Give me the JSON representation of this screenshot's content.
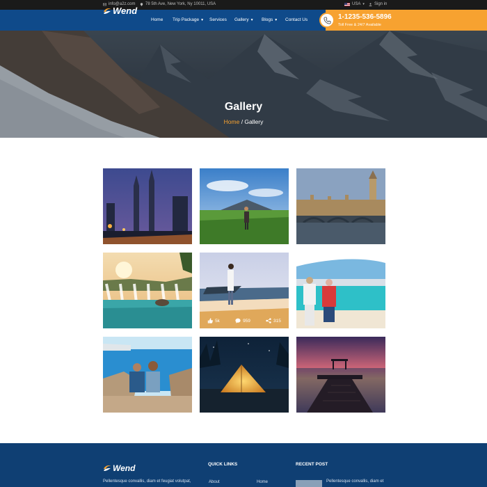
{
  "topbar": {
    "email": "info@a2z.com",
    "address": "78 5th Ave, New York, Ny 10011, USA",
    "language": "USA",
    "signin": "Sign in"
  },
  "nav": {
    "logo": "Wend",
    "items": [
      {
        "label": "Home",
        "dropdown": false
      },
      {
        "label": "Trip Package",
        "dropdown": true
      },
      {
        "label": "Services",
        "dropdown": false
      },
      {
        "label": "Gallery",
        "dropdown": true
      },
      {
        "label": "Blogs",
        "dropdown": true
      },
      {
        "label": "Contact Us",
        "dropdown": false
      }
    ],
    "phone": "1-1235-536-5896",
    "phone_note": "Toll Free & 24/7 Available"
  },
  "hero": {
    "title": "Gallery",
    "crumb_home": "Home",
    "crumb_sep": " / ",
    "crumb_current": "Gallery"
  },
  "gallery": {
    "images": [
      {
        "name": "city-towers-night"
      },
      {
        "name": "hiker-volcano"
      },
      {
        "name": "london-parliament"
      },
      {
        "name": "waterfall-lagoon"
      },
      {
        "name": "beach-photographer"
      },
      {
        "name": "couple-beach-photo"
      },
      {
        "name": "couple-sea-rocks"
      },
      {
        "name": "tent-night"
      },
      {
        "name": "pier-sunset"
      }
    ],
    "hover_stats": {
      "likes": "5k",
      "comments": "959",
      "shares": "315"
    }
  },
  "footer": {
    "logo": "Wend",
    "description": "Pellentesque convallis, diam et feugiat volutpat,",
    "quick_links_title": "QUICK LINKS",
    "links": [
      "About",
      "Home"
    ],
    "recent_post_title": "RECENT POST",
    "recent_post_text": "Pellentesque convallis, diam et"
  },
  "colors": {
    "brand_blue": "#0f4a8a",
    "accent_orange": "#f7a230",
    "footer_blue": "#0f3f73",
    "topbar_dark": "#1a1a1a"
  }
}
